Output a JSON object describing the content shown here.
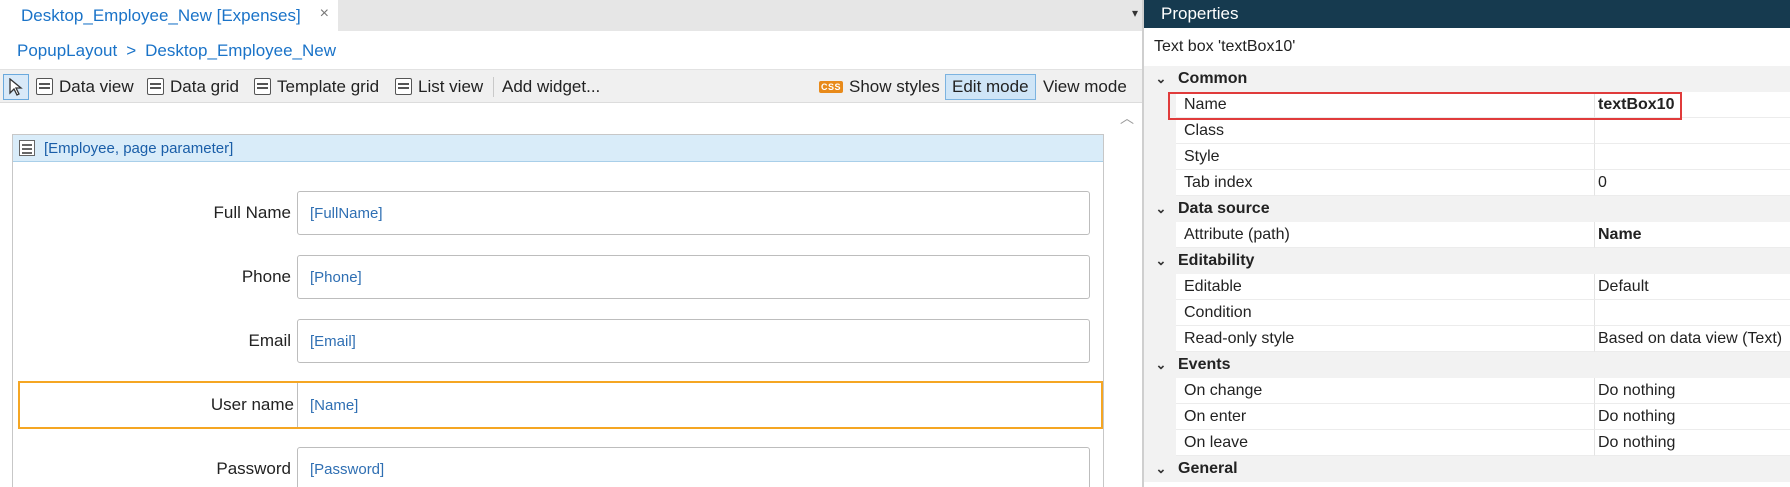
{
  "editor": {
    "tab_title": "Desktop_Employee_New [Expenses]",
    "tab_close": "×",
    "tab_dropdown": "▾",
    "breadcrumb": [
      "PopupLayout",
      ">",
      "Desktop_Employee_New"
    ],
    "toolbar": {
      "data_view": "Data view",
      "data_grid": "Data grid",
      "template_grid": "Template grid",
      "list_view": "List view",
      "add_widget": "Add widget...",
      "css_badge": "CSS",
      "show_styles": "Show styles",
      "edit_mode": "Edit mode",
      "view_mode": "View mode"
    },
    "dataview_header": "[Employee, page parameter]",
    "fields": [
      {
        "label": "Full Name",
        "value": "[FullName]"
      },
      {
        "label": "Phone",
        "value": "[Phone]"
      },
      {
        "label": "Email",
        "value": "[Email]"
      },
      {
        "label": "User name",
        "value": "[Name]",
        "selected": true
      },
      {
        "label": "Password",
        "value": "[Password]"
      }
    ],
    "selection_color": "#f5a623"
  },
  "properties": {
    "title": "Properties",
    "subtitle": "Text box 'textBox10'",
    "categories": [
      {
        "name": "Common",
        "rows": [
          {
            "name": "Name",
            "value": "textBox10",
            "bold": true,
            "highlighted": true
          },
          {
            "name": "Class",
            "value": ""
          },
          {
            "name": "Style",
            "value": ""
          },
          {
            "name": "Tab index",
            "value": "0"
          }
        ]
      },
      {
        "name": "Data source",
        "rows": [
          {
            "name": "Attribute (path)",
            "value": "Name",
            "bold": true
          }
        ]
      },
      {
        "name": "Editability",
        "rows": [
          {
            "name": "Editable",
            "value": "Default"
          },
          {
            "name": "Condition",
            "value": ""
          },
          {
            "name": "Read-only style",
            "value": "Based on data view (Text)"
          }
        ]
      },
      {
        "name": "Events",
        "rows": [
          {
            "name": "On change",
            "value": "Do nothing"
          },
          {
            "name": "On enter",
            "value": "Do nothing"
          },
          {
            "name": "On leave",
            "value": "Do nothing"
          }
        ]
      },
      {
        "name": "General",
        "rows": []
      }
    ],
    "highlight_color": "#e03b3b",
    "header_bg": "#163a4f"
  }
}
